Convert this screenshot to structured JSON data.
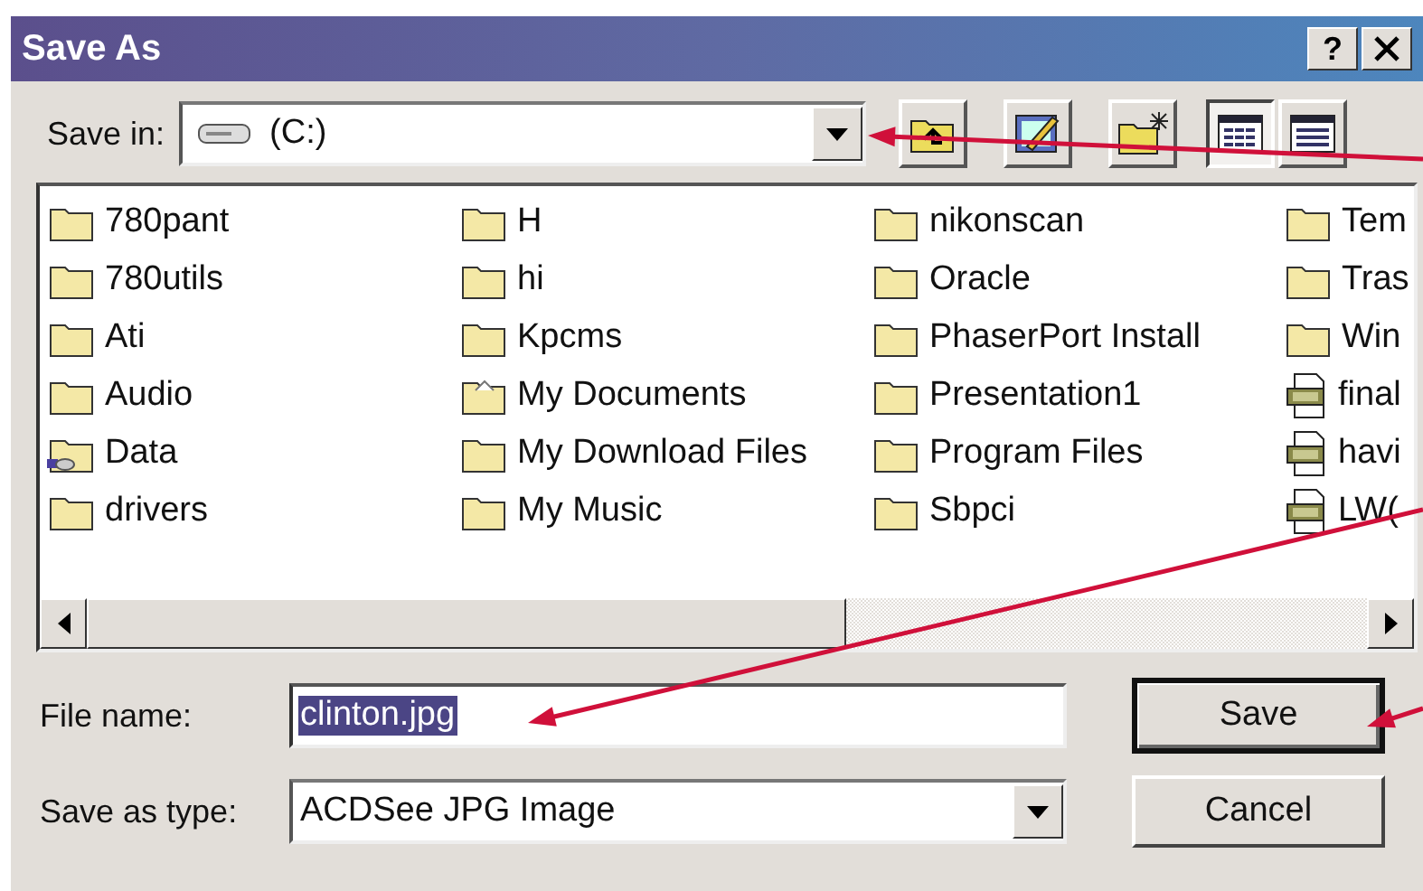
{
  "window": {
    "title": "Save As",
    "help": "?"
  },
  "save_in": {
    "label": "Save in:",
    "value": "(C:)"
  },
  "tool_buttons": [
    {
      "kind": "up-folder"
    },
    {
      "kind": "desktop"
    },
    {
      "kind": "new-folder"
    }
  ],
  "view_buttons": [
    {
      "kind": "list",
      "selected": true
    },
    {
      "kind": "details",
      "selected": false
    }
  ],
  "files": [
    {
      "name": "780pant",
      "kind": "folder"
    },
    {
      "name": "780utils",
      "kind": "folder"
    },
    {
      "name": "Ati",
      "kind": "folder"
    },
    {
      "name": "Audio",
      "kind": "folder"
    },
    {
      "name": "Data",
      "kind": "shared-folder"
    },
    {
      "name": "drivers",
      "kind": "folder"
    },
    {
      "name": "H",
      "kind": "folder"
    },
    {
      "name": "hi",
      "kind": "folder"
    },
    {
      "name": "Kpcms",
      "kind": "folder"
    },
    {
      "name": "My Documents",
      "kind": "special-folder"
    },
    {
      "name": "My Download Files",
      "kind": "folder"
    },
    {
      "name": "My Music",
      "kind": "folder"
    },
    {
      "name": "nikonscan",
      "kind": "folder"
    },
    {
      "name": "Oracle",
      "kind": "folder"
    },
    {
      "name": "PhaserPort Install",
      "kind": "folder"
    },
    {
      "name": "Presentation1",
      "kind": "folder"
    },
    {
      "name": "Program Files",
      "kind": "folder"
    },
    {
      "name": "Sbpci",
      "kind": "folder"
    },
    {
      "name": "Tem",
      "kind": "folder"
    },
    {
      "name": "Tras",
      "kind": "folder"
    },
    {
      "name": "Win",
      "kind": "folder"
    },
    {
      "name": "final",
      "kind": "jpg"
    },
    {
      "name": "havi",
      "kind": "jpg"
    },
    {
      "name": "LW(",
      "kind": "jpg"
    }
  ],
  "file_name": {
    "label": "File name:",
    "value": "clinton.jpg",
    "selected": true
  },
  "save_as_type": {
    "label": "Save as type:",
    "value": "ACDSee JPG Image"
  },
  "buttons": [
    {
      "label": "Save",
      "default": true
    },
    {
      "label": "Cancel",
      "default": false
    }
  ]
}
